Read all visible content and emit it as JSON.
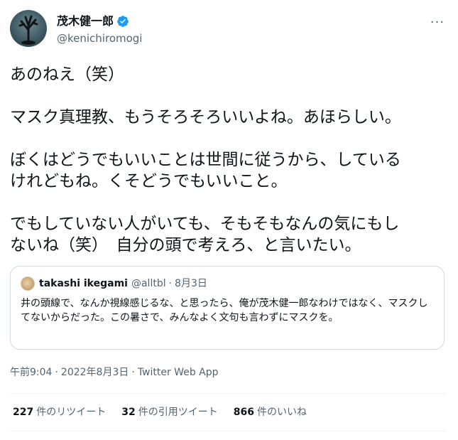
{
  "author": {
    "display_name": "茂木健一郎",
    "handle": "@kenichiromogi",
    "verified_color": "#1d9bf0"
  },
  "more_glyph": "···",
  "tweet": {
    "text": "あのねえ（笑）\n\nマスク真理教、もうそろそろいいよね。あほらしい。\n\nぼくはどうでもいいことは世間に従うから、している\nけれどもね。くそどうでもいいこと。\n\nでもしていない人がいても、そもそもなんの気にもし\nないね（笑）　自分の頭で考えろ、と言いたい。"
  },
  "quote": {
    "name": "takashi ikegami",
    "handle": "@alltbl",
    "separator": "·",
    "date": "8月3日",
    "text": "井の頭線で、なんか視線感じるな、と思ったら、俺が茂木健一郎なわけではなく、マスクしてないからだった。この暑さで、みんなよく文句も言わずにマスクを。"
  },
  "meta": {
    "time": "午前9:04",
    "date": "2022年8月3日",
    "source": "Twitter Web App",
    "dot": "·"
  },
  "stats": {
    "retweets_count": "227",
    "retweets_label": "件のリツイート",
    "quotes_count": "32",
    "quotes_label": "件の引用ツイート",
    "likes_count": "866",
    "likes_label": "件のいいね"
  }
}
